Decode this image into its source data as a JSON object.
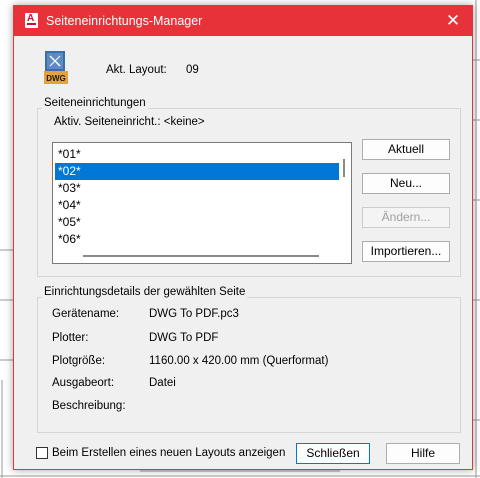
{
  "window": {
    "title": "Seiteneinrichtungs-Manager",
    "close_glyph": "✕"
  },
  "layout": {
    "label": "Akt. Layout:",
    "value": "09",
    "file_icon_text": "DWG"
  },
  "page_setups": {
    "group_title": "Seiteneinrichtungen",
    "active_label": "Aktiv. Seiteneinricht.: <keine>",
    "items": [
      "*01*",
      "*02*",
      "*03*",
      "*04*",
      "*05*",
      "*06*"
    ],
    "selected_index": 1,
    "buttons": {
      "current": "Aktuell",
      "new": "Neu...",
      "modify": "Ändern...",
      "import": "Importieren..."
    }
  },
  "details": {
    "group_title": "Einrichtungsdetails der gewählten Seite",
    "rows": [
      {
        "label": "Gerätename:",
        "value": "DWG To PDF.pc3"
      },
      {
        "label": "Plotter:",
        "value": "DWG To PDF"
      },
      {
        "label": "Plotgröße:",
        "value": "1160.00 x 420.00 mm (Querformat)"
      },
      {
        "label": "Ausgabeort:",
        "value": "Datei"
      },
      {
        "label": "Beschreibung:",
        "value": ""
      }
    ]
  },
  "footer": {
    "checkbox_label": "Beim Erstellen eines neuen Layouts anzeigen",
    "checkbox_checked": false,
    "close_label": "Schließen",
    "help_label": "Hilfe"
  },
  "colors": {
    "titlebar": "#e8323a",
    "selection": "#0078d7",
    "dialog_bg": "#f0f0f0"
  }
}
